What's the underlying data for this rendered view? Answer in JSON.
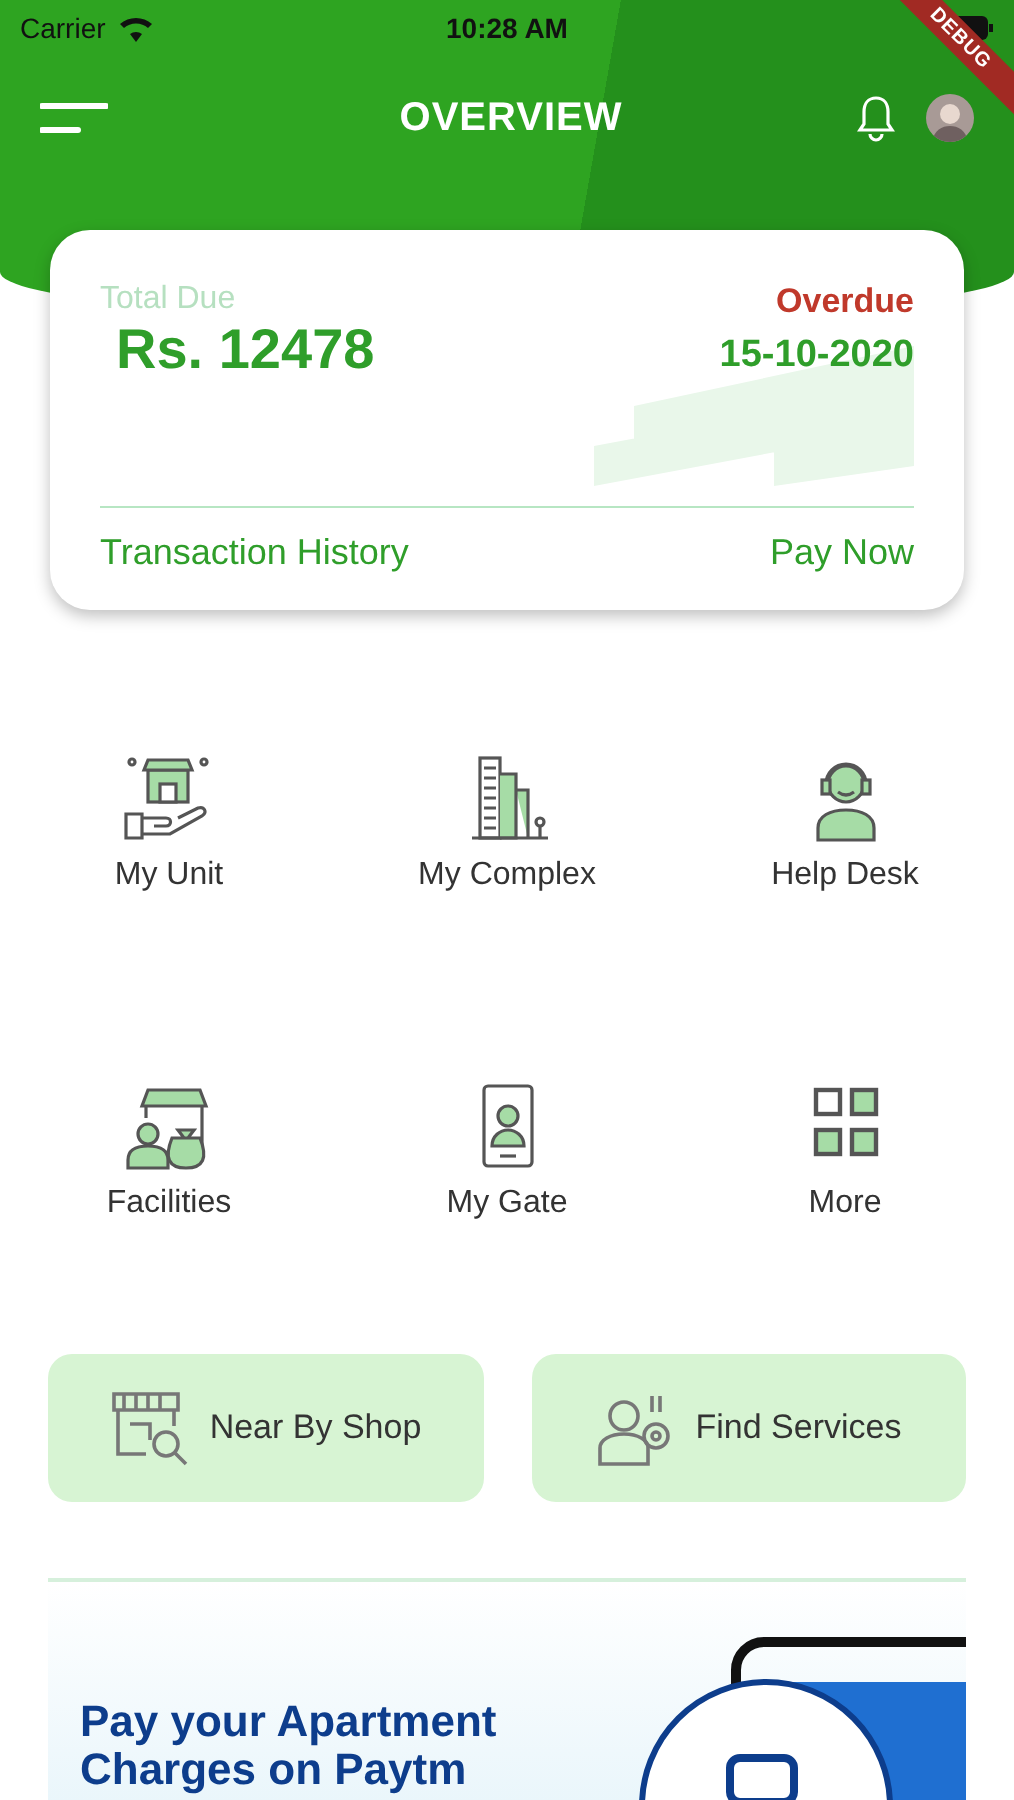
{
  "status_bar": {
    "carrier": "Carrier",
    "time": "10:28 AM"
  },
  "debug_banner": "DEBUG",
  "app_bar": {
    "title": "OVERVIEW"
  },
  "due_card": {
    "label": "Total Due",
    "amount": "Rs. 12478",
    "status": "Overdue",
    "date": "15-10-2020",
    "history_link": "Transaction History",
    "pay_link": "Pay Now"
  },
  "menu": [
    {
      "label": "My Unit",
      "kind": "unit"
    },
    {
      "label": "My Complex",
      "kind": "complex"
    },
    {
      "label": "Help Desk",
      "kind": "helpdesk"
    },
    {
      "label": "Facilities",
      "kind": "facilities"
    },
    {
      "label": "My Gate",
      "kind": "gate"
    },
    {
      "label": "More",
      "kind": "more"
    }
  ],
  "quick_actions": [
    {
      "label": "Near By Shop",
      "kind": "shop"
    },
    {
      "label": "Find Services",
      "kind": "services"
    }
  ],
  "promo": {
    "headline": "Pay your Apartment Charges on Paytm",
    "kind": "picture"
  }
}
